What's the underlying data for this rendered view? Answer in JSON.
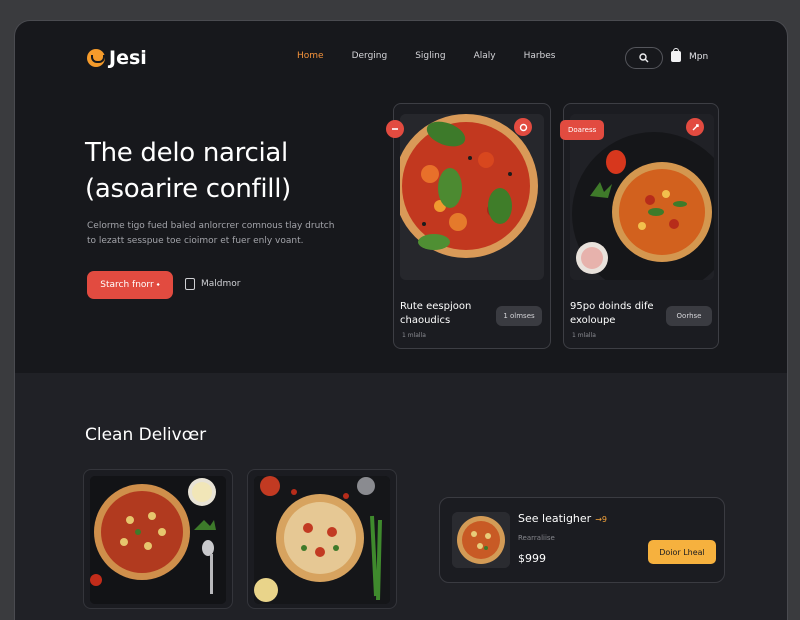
{
  "brand": {
    "name": "Jesi"
  },
  "nav": {
    "links": [
      "Home",
      "Derging",
      "Sigling",
      "Alaly",
      "Harbes"
    ],
    "active_index": 0,
    "cart_label": "Mpn"
  },
  "hero": {
    "title_line1": "The delo narcial",
    "title_line2": "(asoarire confill)",
    "description": "Celorme tigo fued baled anlorcrer comnous tlay drutch to lezatt sesspue toe cioimor et fuer enly voant.",
    "primary_button": "Starch fnorr ⬩",
    "secondary_link": "Maldmor"
  },
  "featured": [
    {
      "title": "Rute eespjoon chaoudics",
      "subtitle": "1 mlalla",
      "button": "1 olmses",
      "tag": ""
    },
    {
      "title": "95po doinds dife exoloupe",
      "subtitle": "1 mlalla",
      "button": "Oorhse",
      "tag": "Doaress"
    }
  ],
  "section": {
    "title": "Clean Delivœr"
  },
  "deal": {
    "title": "See leatigher",
    "tag": "→9",
    "subtitle": "Rearraliise",
    "price": "$999",
    "button": "Doior Lheal"
  },
  "colors": {
    "accent": "#e24b40",
    "brand_orange": "#f59b2b",
    "deal_button": "#f6b13e",
    "background": "#17181c"
  }
}
